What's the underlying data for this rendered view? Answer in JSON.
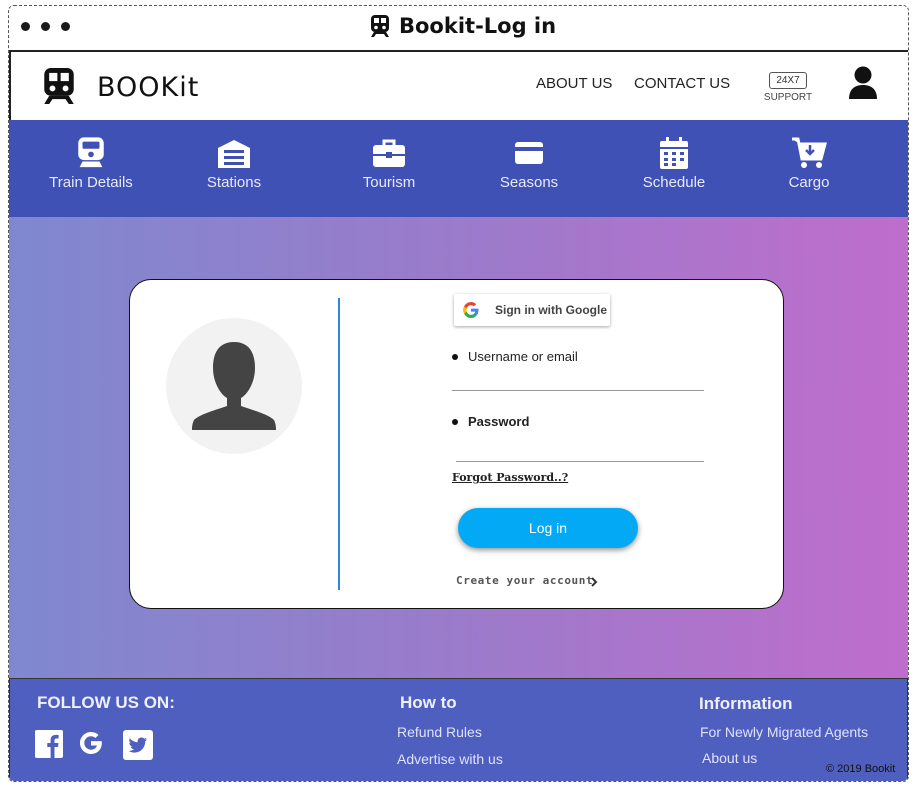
{
  "window": {
    "title": "Bookit-Log in"
  },
  "header": {
    "logo_text": "BOOKit",
    "links": [
      "ABOUT US",
      "CONTACT US"
    ],
    "support_badge": "24X7",
    "support_label": "SUPPORT"
  },
  "nav": {
    "items": [
      {
        "label": "Train Details",
        "icon": "train-icon"
      },
      {
        "label": "Stations",
        "icon": "station-icon"
      },
      {
        "label": "Tourism",
        "icon": "briefcase-icon"
      },
      {
        "label": "Seasons",
        "icon": "card-icon"
      },
      {
        "label": "Schedule",
        "icon": "calendar-icon"
      },
      {
        "label": "Cargo",
        "icon": "cart-icon"
      }
    ]
  },
  "login": {
    "google_label": "Sign in with Google",
    "username_label": "Username or email",
    "username_value": "",
    "password_label": "Password",
    "password_value": "",
    "forgot_label": "Forgot Password..?",
    "login_label": "Log in",
    "create_label": "Create your account"
  },
  "footer": {
    "follow_title": "FOLLOW US ON:",
    "social_icons": [
      "facebook-icon",
      "google-icon",
      "twitter-icon"
    ],
    "howto_title": "How to",
    "howto_links": [
      "Refund Rules",
      "Advertise with us"
    ],
    "info_title": "Information",
    "info_links": [
      "For Newly Migrated Agents",
      "About us"
    ],
    "copyright": "© 2019 Bookit"
  },
  "colors": {
    "nav_bg": "#3f51b5",
    "footer_bg": "#4e5fbf",
    "login_button": "#03a9f4",
    "gradient_start": "#7f88cf",
    "gradient_end": "#bf6dcc"
  }
}
